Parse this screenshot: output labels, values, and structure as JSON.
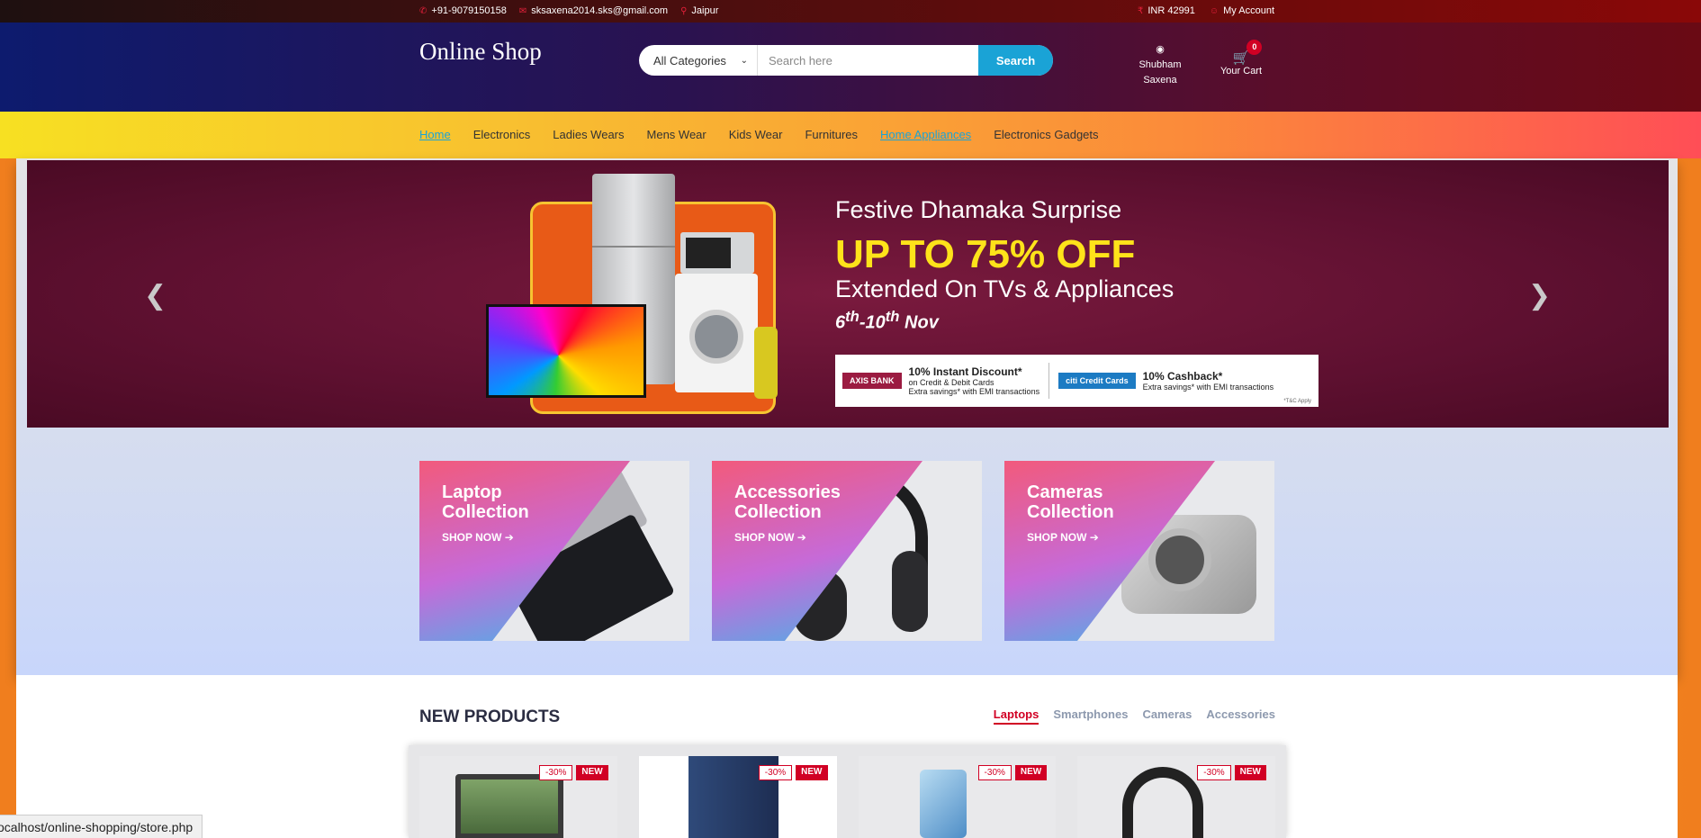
{
  "topbar": {
    "phone": "+91-9079150158",
    "email": "sksaxena2014.sks@gmail.com",
    "location": "Jaipur",
    "currency": "INR 42991",
    "account": "My Account"
  },
  "header": {
    "logo": "Online Shop",
    "search": {
      "category": "All Categories",
      "placeholder": "Search here",
      "button": "Search"
    },
    "user_line1": "Shubham",
    "user_line2": "Saxena",
    "cart_label": "Your Cart",
    "cart_qty": "0"
  },
  "nav": {
    "items": [
      "Home",
      "Electronics",
      "Ladies Wears",
      "Mens Wear",
      "Kids Wear",
      "Furnitures",
      "Home Appliances",
      "Electronics Gadgets"
    ]
  },
  "banner": {
    "title": "Festive Dhamaka Surprise",
    "offer": "UP TO 75% OFF",
    "subtitle": "Extended On TVs & Appliances",
    "date_start": "6",
    "date_sup1": "th",
    "date_end": "-10",
    "date_sup2": "th",
    "date_month": " Nov",
    "offer1_bank": "AXIS BANK",
    "offer1_title": "10% Instant Discount*",
    "offer1_line1": "on Credit & Debit Cards",
    "offer1_line2": "Extra savings* with EMI transactions",
    "offer2_bank": "citi Credit Cards",
    "offer2_title": "10% Cashback*",
    "offer2_line1": "Extra savings* with EMI transactions",
    "tsc": "*T&C Apply"
  },
  "collections": [
    {
      "title_line1": "Laptop",
      "title_line2": "Collection",
      "cta": "SHOP NOW"
    },
    {
      "title_line1": "Accessories",
      "title_line2": "Collection",
      "cta": "SHOP NOW"
    },
    {
      "title_line1": "Cameras",
      "title_line2": "Collection",
      "cta": "SHOP NOW"
    }
  ],
  "new_products": {
    "title": "NEW PRODUCTS",
    "tabs": [
      "Laptops",
      "Smartphones",
      "Cameras",
      "Accessories"
    ],
    "cards": [
      {
        "sale": "-30%",
        "label": "NEW"
      },
      {
        "sale": "-30%",
        "label": "NEW"
      },
      {
        "sale": "-30%",
        "label": "NEW"
      },
      {
        "sale": "-30%",
        "label": "NEW"
      }
    ]
  },
  "statusbar": {
    "url": "ocalhost/online-shopping/store.php"
  },
  "colors": {
    "accent": "#d10024",
    "search_button": "#1aa3d6",
    "promo_yellow": "#fee31a"
  }
}
